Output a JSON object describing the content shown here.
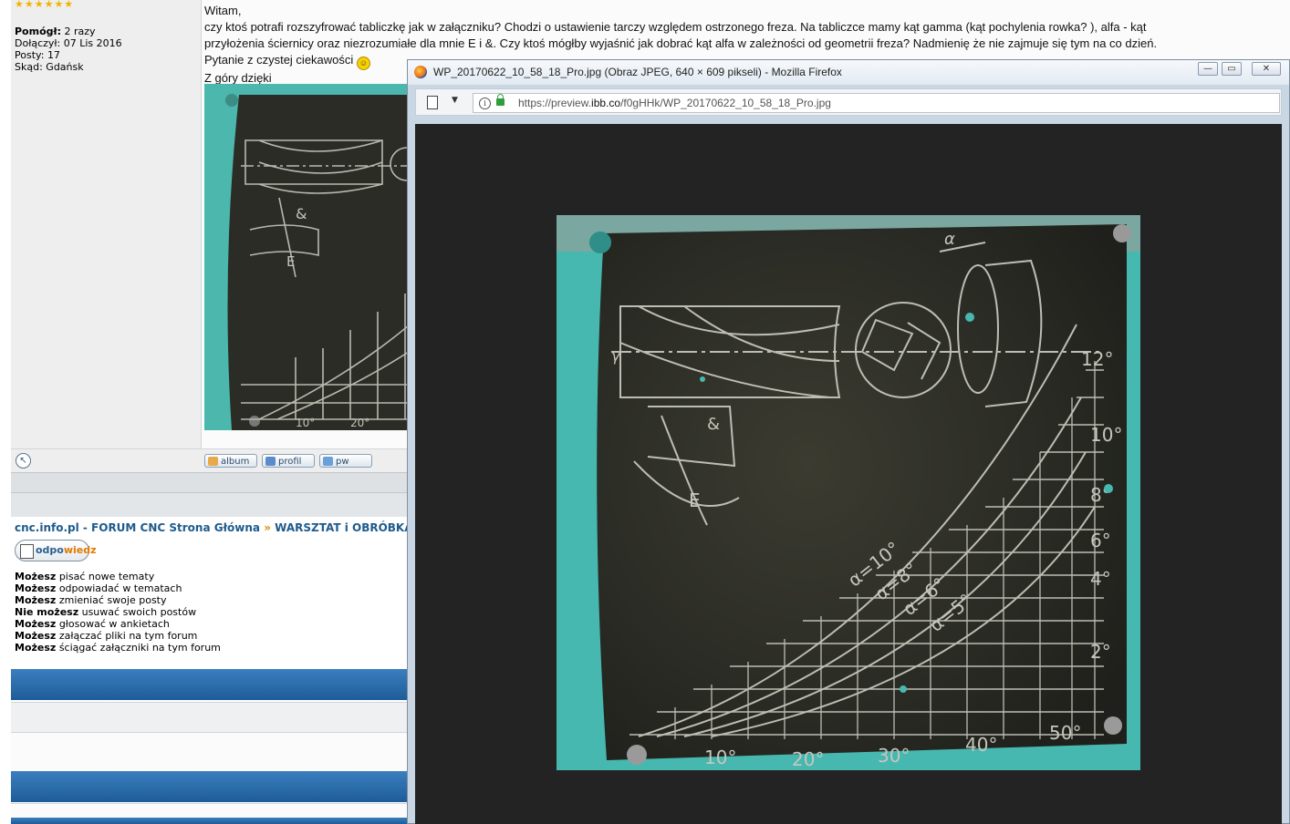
{
  "profile": {
    "stars": "★★★★★★",
    "helped_label": "Pomógł:",
    "helped_value": "2 razy",
    "joined_label": "Dołączył:",
    "joined_value": "07 Lis 2016",
    "posts_label": "Posty:",
    "posts_value": "17",
    "from_label": "Skąd:",
    "from_value": "Gdańsk"
  },
  "post": {
    "line1": "Witam,",
    "line2": "czy ktoś potrafi rozszyfrować tabliczkę jak w załączniku? Chodzi o ustawienie tarczy względem ostrzonego freza. Na tabliczce mamy kąt gamma (kąt pochylenia rowka? ), alfa - kąt",
    "line3": "przyłożenia ściernicy oraz niezrozumiałe dla mnie E i &. Czy ktoś mógłby wyjaśnić jak dobrać kąt alfa w zależności od geometrii freza? Nadmienię że nie zajmuje się tym na co dzień.",
    "line4": "Pytanie z czystej ciekawości",
    "line5": "Z góry dzięki"
  },
  "buttons": {
    "album": "album",
    "profile": "profil",
    "pm": "pw"
  },
  "breadcrumb": {
    "home": "cnc.info.pl - FORUM CNC Strona Główna",
    "separator": "»",
    "section": "WARSZTAT i OBRÓBKA MA"
  },
  "reply": {
    "label": "odpowiedz",
    "label_a": "odpo",
    "label_b": "wiedz"
  },
  "permissions": [
    {
      "mode": "Możesz",
      "text": "pisać nowe tematy"
    },
    {
      "mode": "Możesz",
      "text": "odpowiadać w tematach"
    },
    {
      "mode": "Możesz",
      "text": "zmieniać swoje posty"
    },
    {
      "mode": "Nie możesz",
      "text": "usuwać swoich postów"
    },
    {
      "mode": "Możesz",
      "text": "głosować w ankietach"
    },
    {
      "mode": "Możesz",
      "text": "załączać pliki na tym forum"
    },
    {
      "mode": "Możesz",
      "text": "ściągać załączniki na tym forum"
    }
  ],
  "popup": {
    "title": "WP_20170622_10_58_18_Pro.jpg (Obraz JPEG, 640 × 609 pikseli) - Mozilla Firefox",
    "url_prefix": "https://preview.",
    "url_domain": "ibb.co",
    "url_path": "/f0gHHk/WP_20170622_10_58_18_Pro.jpg",
    "minimize": "—",
    "restore": "▭",
    "close": "✕"
  },
  "plate": {
    "gamma": "γ",
    "amp": "&",
    "e": "E",
    "alpha": "α",
    "right_ticks": [
      "12°",
      "10°",
      "8°",
      "6°",
      "4°",
      "2°"
    ],
    "bottom_ticks": [
      "10°",
      "20°",
      "30°",
      "40°",
      "50°"
    ],
    "curves": [
      "α=10°",
      "α=8°",
      "α=6°",
      "α=5°"
    ]
  },
  "colors": {
    "accent_blue": "#1e5c98",
    "link": "#1e5b8c",
    "plate": "#2b2c25",
    "paint": "#46b8b0"
  }
}
